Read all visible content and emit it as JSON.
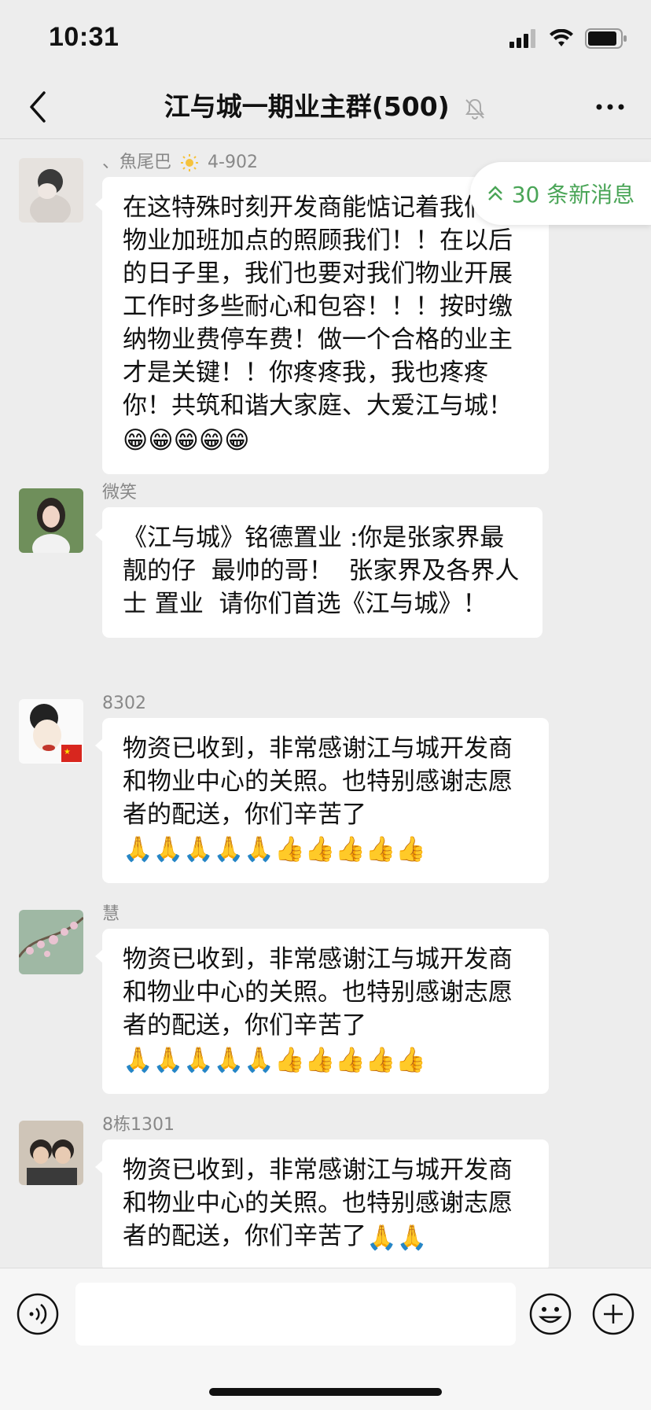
{
  "status_bar": {
    "time": "10:31",
    "battery_level": 0.9
  },
  "header": {
    "back_icon": "chevron-left-icon",
    "title": "江与城一期业主群(500)",
    "mute_icon": "bell-mute-icon",
    "more_icon": "more-dots-icon"
  },
  "new_messages": {
    "label": "30 条新消息",
    "icon": "double-chevron-up-icon",
    "color": "#4aa557"
  },
  "messages": [
    {
      "sender": "、魚尾巴",
      "sender_suffix": "4-902",
      "text": "在这特殊时刻开发商能惦记着我们，物业加班加点的照顾我们！！在以后的日子里，我们也要对我们物业开展工作时多些耐心和包容！！！按时缴纳物业费停车费！做一个合格的业主才是关键！！你疼疼我，我也疼疼你！共筑和谐大家庭、大爱江与城！",
      "emojis": "😁😁😁😁😁"
    },
    {
      "sender": "微笑",
      "text": "《江与城》铭德置业 :你是张家界最靓的仔  最帅的哥！  张家界及各界人士 置业  请你们首选《江与城》！",
      "emojis": ""
    },
    {
      "sender": "8302",
      "text": "物资已收到，非常感谢江与城开发商和物业中心的关照。也特别感谢志愿者的配送，你们辛苦了",
      "emojis": "🙏🙏🙏🙏🙏👍👍👍👍👍"
    },
    {
      "sender": "慧",
      "text": "物资已收到，非常感谢江与城开发商和物业中心的关照。也特别感谢志愿者的配送，你们辛苦了",
      "emojis": "🙏🙏🙏🙏🙏👍👍👍👍👍"
    },
    {
      "sender": "8栋1301",
      "text": "物资已收到，非常感谢江与城开发商和物业中心的关照。也特别感谢志愿者的配送，你们辛苦了",
      "emojis": "🙏🙏"
    }
  ],
  "input_bar": {
    "voice_icon": "voice-icon",
    "emoji_icon": "smiley-icon",
    "plus_icon": "plus-circle-icon",
    "placeholder": ""
  }
}
